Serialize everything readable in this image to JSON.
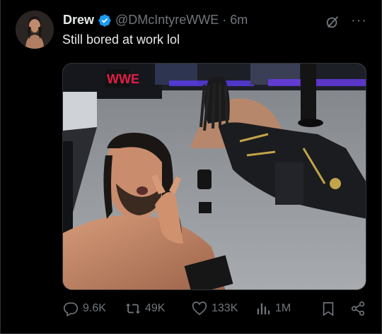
{
  "author": {
    "name": "Drew",
    "handle": "@DMcIntyreWWE",
    "separator": "·",
    "time": "6m"
  },
  "tweet": {
    "text": "Still bored at work lol"
  },
  "media": {
    "description_icon": "photo-icon",
    "banner_text": "WWE"
  },
  "actions": {
    "replies": "9.6K",
    "reposts": "49K",
    "likes": "133K",
    "views": "1M"
  },
  "colors": {
    "background": "#000000",
    "text": "#e7e9ea",
    "muted": "#71767b",
    "verified": "#1d9bf0",
    "border": "#2f3336"
  }
}
